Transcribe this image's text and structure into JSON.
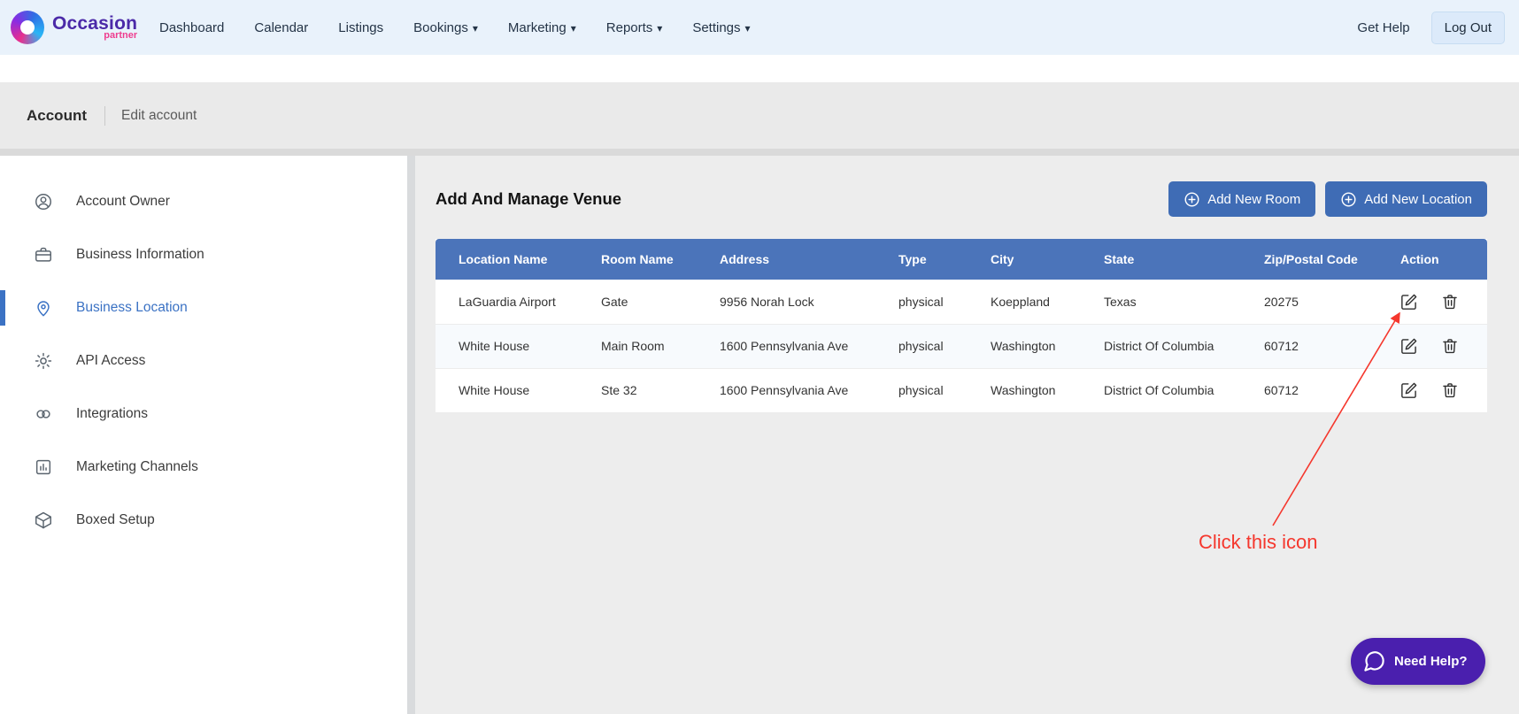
{
  "navbar": {
    "logo": {
      "title": "Occasion",
      "subtitle": "partner"
    },
    "items": [
      {
        "label": "Dashboard",
        "has_dropdown": false
      },
      {
        "label": "Calendar",
        "has_dropdown": false
      },
      {
        "label": "Listings",
        "has_dropdown": false
      },
      {
        "label": "Bookings",
        "has_dropdown": true
      },
      {
        "label": "Marketing",
        "has_dropdown": true
      },
      {
        "label": "Reports",
        "has_dropdown": true
      },
      {
        "label": "Settings",
        "has_dropdown": true
      }
    ],
    "get_help_label": "Get Help",
    "log_out_label": "Log Out"
  },
  "breadcrumb": {
    "section": "Account",
    "current": "Edit account"
  },
  "sidebar": {
    "active_item": "Business Location",
    "items": [
      {
        "label": "Account Owner",
        "icon": "user-icon"
      },
      {
        "label": "Business Information",
        "icon": "briefcase-icon"
      },
      {
        "label": "Business Location",
        "icon": "location-pin-icon"
      },
      {
        "label": "API Access",
        "icon": "gear-icon"
      },
      {
        "label": "Integrations",
        "icon": "rings-icon"
      },
      {
        "label": "Marketing Channels",
        "icon": "bar-chart-icon"
      },
      {
        "label": "Boxed Setup",
        "icon": "box-icon"
      }
    ]
  },
  "content": {
    "title": "Add And Manage Venue",
    "add_room_label": "Add New Room",
    "add_location_label": "Add New Location",
    "table": {
      "headers": [
        "Location Name",
        "Room Name",
        "Address",
        "Type",
        "City",
        "State",
        "Zip/Postal Code",
        "Action"
      ],
      "rows": [
        {
          "location_name": "LaGuardia Airport",
          "room_name": "Gate",
          "address": "9956 Norah Lock",
          "type": "physical",
          "city": "Koeppland",
          "state": "Texas",
          "zip": "20275"
        },
        {
          "location_name": "White House",
          "room_name": "Main Room",
          "address": "1600 Pennsylvania Ave",
          "type": "physical",
          "city": "Washington",
          "state": "District Of Columbia",
          "zip": "60712"
        },
        {
          "location_name": "White House",
          "room_name": "Ste 32",
          "address": "1600 Pennsylvania Ave",
          "type": "physical",
          "city": "Washington",
          "state": "District Of Columbia",
          "zip": "60712"
        }
      ]
    }
  },
  "annotation": {
    "label": "Click this icon",
    "color": "#f5372d"
  },
  "help": {
    "label": "Need Help?"
  },
  "colors": {
    "navbar_bg": "#e9f2fb",
    "table_header": "#4b74ba",
    "primary_button": "#3f6cb5",
    "active_sidebar": "#3b72c4",
    "help_button": "#4a1fae",
    "logo_purple": "#4b2aa8",
    "logo_pink": "#ee3d8f"
  }
}
